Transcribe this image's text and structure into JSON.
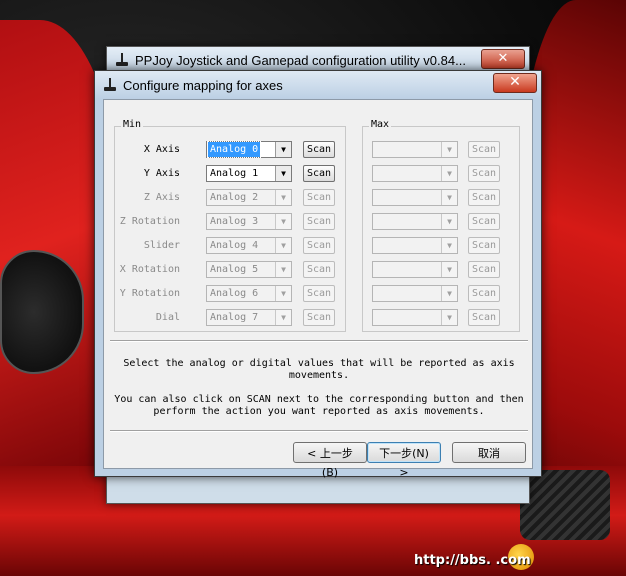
{
  "back_window": {
    "title": "PPJoy Joystick and Gamepad configuration utility  v0.84...",
    "close_glyph": "✕"
  },
  "dialog": {
    "title": "Configure mapping for axes",
    "close_glyph": "✕",
    "min_group": "Min",
    "max_group": "Max",
    "rows": [
      {
        "label": "X Axis",
        "min_value": "Analog 0",
        "scan": "Scan"
      },
      {
        "label": "Y Axis",
        "min_value": "Analog 1",
        "scan": "Scan"
      },
      {
        "label": "Z Axis",
        "min_value": "Analog 2",
        "scan": "Scan"
      },
      {
        "label": "Z Rotation",
        "min_value": "Analog 3",
        "scan": "Scan"
      },
      {
        "label": "Slider",
        "min_value": "Analog 4",
        "scan": "Scan"
      },
      {
        "label": "X Rotation",
        "min_value": "Analog 5",
        "scan": "Scan"
      },
      {
        "label": "Y Rotation",
        "min_value": "Analog 6",
        "scan": "Scan"
      },
      {
        "label": "Dial",
        "min_value": "Analog 7",
        "scan": "Scan"
      }
    ],
    "info_line1": "Select the analog or digital values that will be reported as axis",
    "info_line2": "movements.",
    "info_line3": "You can also click on SCAN next to the corresponding button and then",
    "info_line4": "perform the action you want reported as axis movements.",
    "back_button": "< 上一步(B)",
    "next_button": "下一步(N) >",
    "cancel_button": "取消"
  },
  "watermark": {
    "text": "http://bbs.         .com"
  },
  "icons": {
    "dropdown": "chevron-down-icon",
    "app": "joystick-icon",
    "close": "close-icon"
  },
  "colors": {
    "selection": "#3399ff",
    "dialog_frame": "#bcd0e4",
    "client_bg": "#f0f0f0"
  }
}
